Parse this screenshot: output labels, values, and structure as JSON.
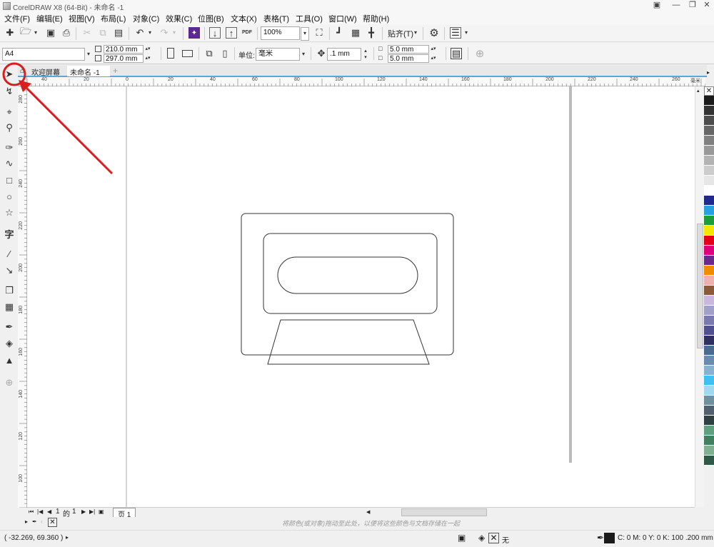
{
  "window": {
    "title": "CorelDRAW X8 (64-Bit) - 未命名 -1"
  },
  "menu": [
    "文件(F)",
    "编辑(E)",
    "视图(V)",
    "布局(L)",
    "对象(C)",
    "效果(C)",
    "位图(B)",
    "文本(X)",
    "表格(T)",
    "工具(O)",
    "窗口(W)",
    "帮助(H)"
  ],
  "toolbar": {
    "zoom": "100%",
    "snap_label": "贴齐(T)",
    "pdf_label": "PDF"
  },
  "property_bar": {
    "page_size": "A4",
    "width": "210.0 mm",
    "height": "297.0 mm",
    "unit_label": "单位:",
    "unit": "毫米",
    "nudge": ".1 mm",
    "dup_x": "5.0 mm",
    "dup_y": "5.0 mm"
  },
  "tabs": [
    "欢迎屏幕",
    "未命名 -1"
  ],
  "ruler": {
    "h_ticks": [
      "40",
      "20",
      "0",
      "20",
      "40",
      "60",
      "80",
      "100",
      "120",
      "140",
      "160",
      "180",
      "200",
      "220",
      "240",
      "260"
    ],
    "unit": "毫米",
    "v_ticks": [
      "280",
      "260",
      "240",
      "220",
      "200",
      "180",
      "160",
      "140",
      "120",
      "100"
    ]
  },
  "pagenav": {
    "current": "1",
    "of_label": "的",
    "total": "1",
    "page_tab": "页 1"
  },
  "doc_palette_hint": "将颜色(或对象)拖动至此处，以便将这些颜色与文档存储在一起",
  "status": {
    "coords": "( -32.269, 69.360 )",
    "fill_label": "无",
    "outline_info": "C: 0 M: 0 Y: 0 K: 100  .200 mm"
  },
  "palette_colors": [
    "#1a1a1a",
    "#333333",
    "#4d4d4d",
    "#666666",
    "#808080",
    "#999999",
    "#b3b3b3",
    "#cccccc",
    "#e6e6e6",
    "#ffffff",
    "#1f2a8a",
    "#2aa0e0",
    "#1e9c3a",
    "#f5e600",
    "#e0001a",
    "#e0007a",
    "#6a2a8a",
    "#f08c00",
    "#f0b0b0",
    "#8b5a3a",
    "#c8b8e0",
    "#a0a0c8",
    "#7a7ab0",
    "#505090",
    "#303060",
    "#4a6a90",
    "#6a8ab0",
    "#8ab0d0",
    "#40c0f0",
    "#a0d8f0",
    "#7090a0",
    "#506070",
    "#304040",
    "#60a080",
    "#408060",
    "#80b090",
    "#305848"
  ],
  "accent_color": "#d81e1e"
}
